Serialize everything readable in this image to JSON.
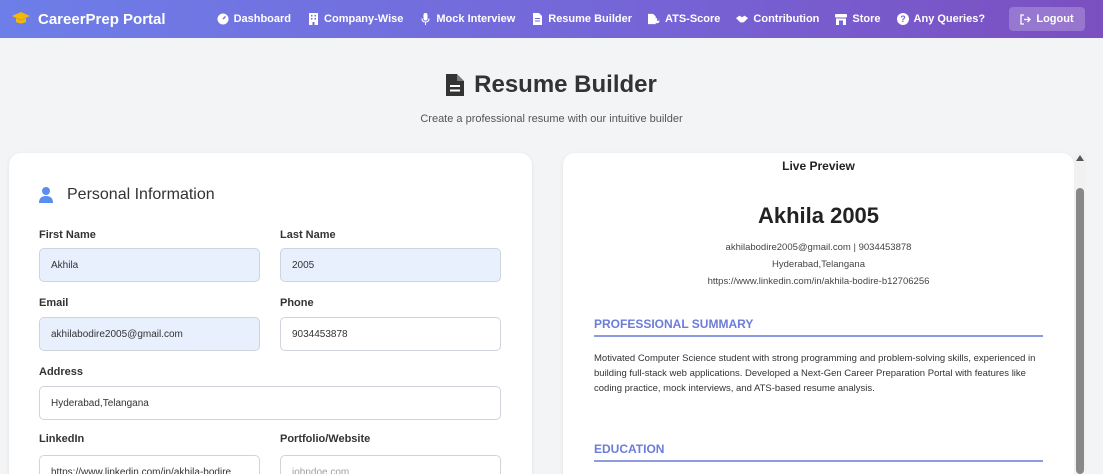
{
  "navbar": {
    "brand": "CareerPrep Portal",
    "items": [
      {
        "label": "Dashboard",
        "icon": "gauge-icon"
      },
      {
        "label": "Company-Wise",
        "icon": "building-icon"
      },
      {
        "label": "Mock Interview",
        "icon": "microphone-icon"
      },
      {
        "label": "Resume Builder",
        "icon": "file-icon"
      },
      {
        "label": "ATS-Score",
        "icon": "file-chart-icon"
      },
      {
        "label": "Contribution",
        "icon": "handshake-icon"
      },
      {
        "label": "Store",
        "icon": "store-icon"
      },
      {
        "label": "Any Queries?",
        "icon": "question-icon"
      }
    ],
    "logout": "Logout"
  },
  "header": {
    "title": "Resume Builder",
    "subtitle": "Create a professional resume with our intuitive builder"
  },
  "form": {
    "section_title": "Personal Information",
    "first_name_label": "First Name",
    "first_name": "Akhila",
    "last_name_label": "Last Name",
    "last_name": "2005",
    "email_label": "Email",
    "email": "akhilabodire2005@gmail.com",
    "phone_label": "Phone",
    "phone": "9034453878",
    "address_label": "Address",
    "address": "Hyderabad,Telangana",
    "linkedin_label": "LinkedIn",
    "linkedin": "https://www.linkedin.com/in/akhila-bodire",
    "portfolio_label": "Portfolio/Website",
    "portfolio_placeholder": "johndoe.com"
  },
  "preview": {
    "header": "Live Preview",
    "name": "Akhila 2005",
    "contact": "akhilabodire2005@gmail.com | 9034453878",
    "address": "Hyderabad,Telangana",
    "linkedin": "https://www.linkedin.com/in/akhila-bodire-b12706256",
    "summary_heading": "PROFESSIONAL SUMMARY",
    "summary": "Motivated Computer Science student with strong programming and problem-solving skills, experienced in building full-stack web applications. Developed a Next-Gen Career Preparation Portal with features like coding practice, mock interviews, and ATS-based resume analysis.",
    "education_heading": "EDUCATION"
  },
  "colors": {
    "accent": "#6b7cd9",
    "nav_start": "#6d7ee8",
    "nav_end": "#7b4fc0",
    "brand_icon": "#f5b800"
  }
}
